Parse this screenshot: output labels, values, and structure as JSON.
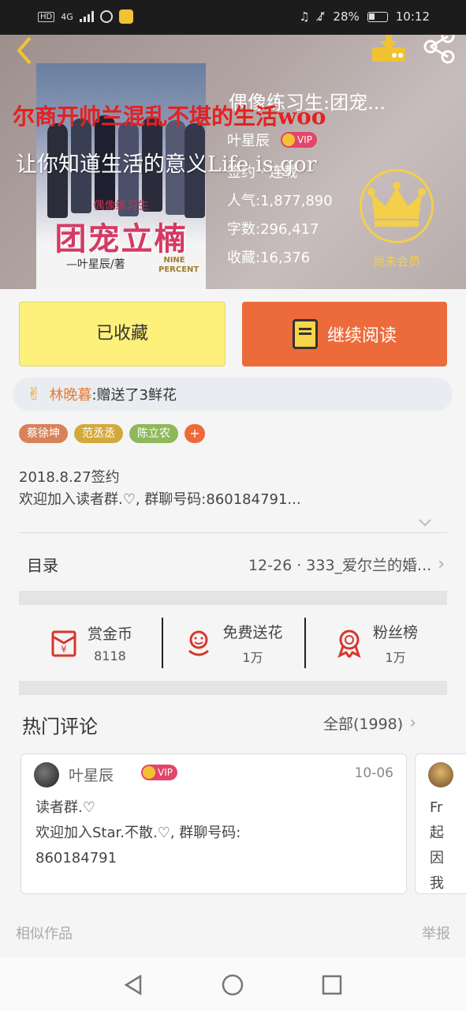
{
  "status_bar": {
    "network_badge": "HD",
    "network_type": "4G",
    "battery": "28%",
    "time": "10:12"
  },
  "header": {
    "book_title": "偶像练习生:团宠...",
    "overlay_text_1": "尔商开帅兰混乱不堪的生活woo",
    "overlay_text_2": "让你知道生活的意义Life is gor",
    "author": "叶星辰",
    "vip_label": "VIP",
    "status": "签约 · 连载",
    "popularity": "人气:1,877,890",
    "word_count": "字数:296,417",
    "collections": "收藏:16,376",
    "member_label": "尚未会员",
    "cover": {
      "subtitle": "偶像练习生",
      "title": "团宠立楠",
      "author": "—叶星辰/著",
      "logo": "NINE PERCENT"
    }
  },
  "actions": {
    "collected_label": "已收藏",
    "continue_read_label": "继续阅读"
  },
  "gift": {
    "name": "林晚暮",
    "text": ":赠送了3鲜花"
  },
  "tags": [
    {
      "label": "蔡徐坤",
      "color": "#d9825a"
    },
    {
      "label": "范丞丞",
      "color": "#d4a93b"
    },
    {
      "label": "陈立农",
      "color": "#8fb85a"
    },
    {
      "label": "+",
      "color": "#ed6b3a"
    }
  ],
  "description": {
    "sign_date": "2018.8.27签约",
    "text": "欢迎加入读者群.♡, 群聊号码:860184791..."
  },
  "catalog": {
    "label": "目录",
    "latest": "12-26 · 333_爱尔兰的婚..."
  },
  "stats": [
    {
      "title": "赏金币",
      "value": "8118",
      "icon": "reward-envelope-icon"
    },
    {
      "title": "免费送花",
      "value": "1万",
      "icon": "flower-icon"
    },
    {
      "title": "粉丝榜",
      "value": "1万",
      "icon": "medal-icon"
    }
  ],
  "comments": {
    "section_title": "热门评论",
    "all_label": "全部(1998)",
    "items": [
      {
        "author": "叶星辰",
        "vip": "VIP",
        "date": "10-06",
        "body_line1": "读者群.♡",
        "body_line2": "欢迎加入Star.不散.♡, 群聊号码:",
        "body_line3": "860184791"
      },
      {
        "body": "Fr\n起\n因\n我"
      }
    ]
  },
  "footer": {
    "similar_label": "相似作品",
    "report_label": "举报"
  },
  "colors": {
    "accent_orange": "#ed6b3a",
    "accent_yellow": "#fdf07b",
    "vip_pink": "#e3456b",
    "icon_red": "#d9362a"
  }
}
